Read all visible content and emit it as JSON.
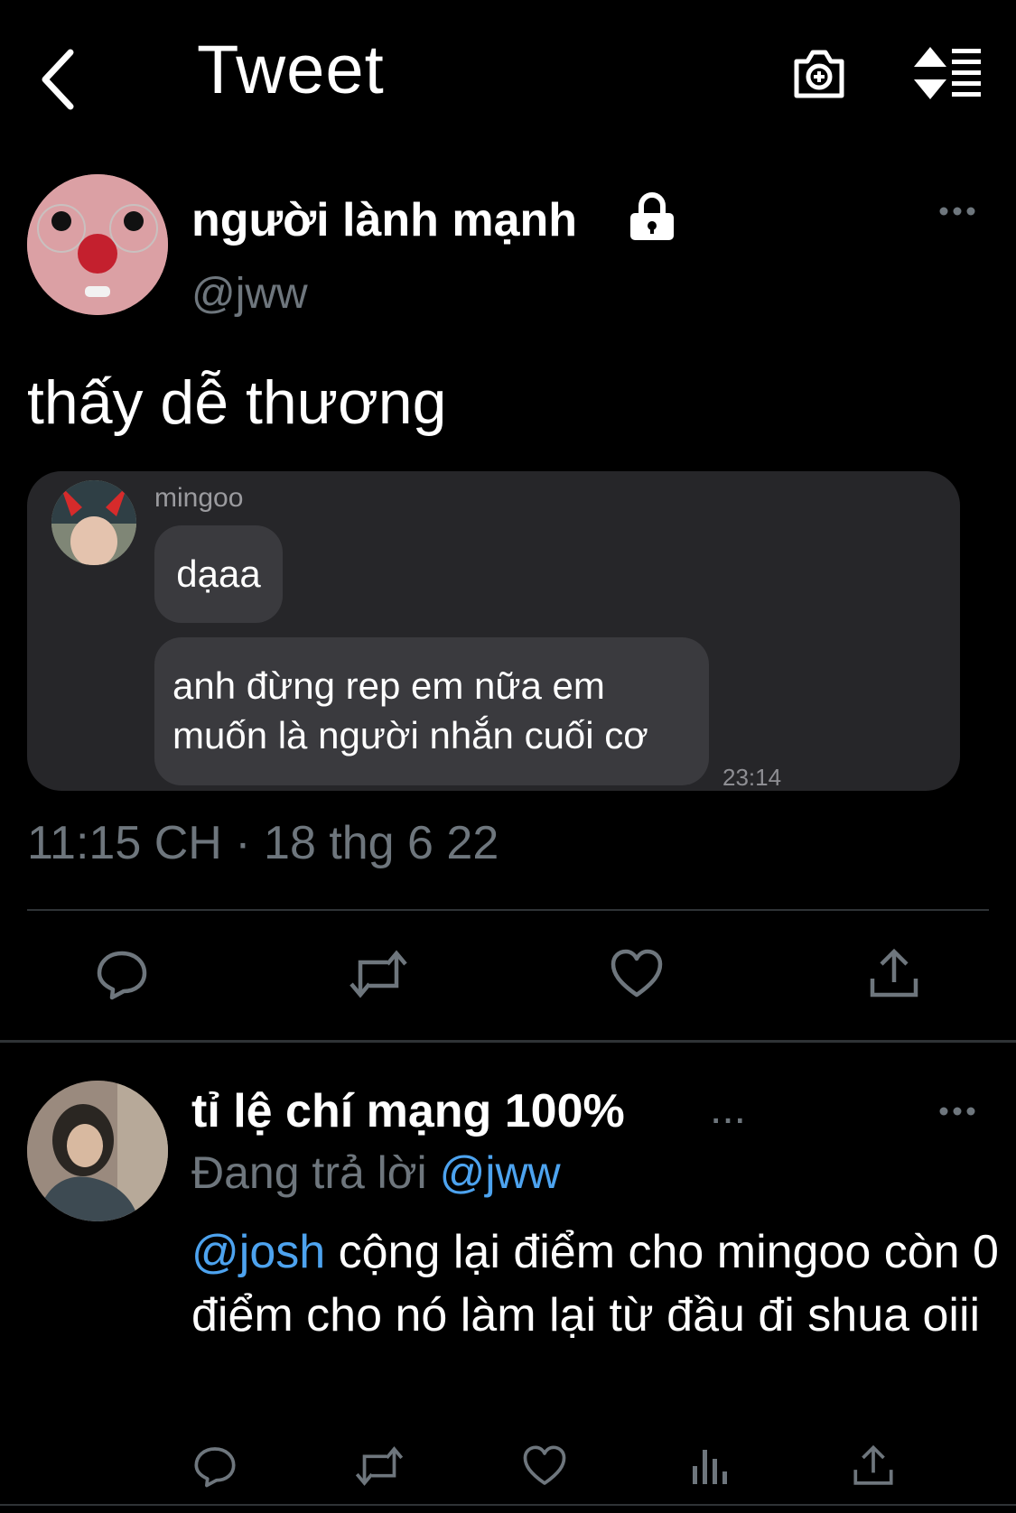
{
  "header": {
    "title": "Tweet",
    "back_icon": "chevron-left-icon",
    "camera_icon": "camera-add-icon",
    "sort_icon": "sort-icon"
  },
  "tweet": {
    "author_name": "người lành mạnh",
    "author_handle": "@jww",
    "text": "thấy dễ thương",
    "image": {
      "sender": "mingoo",
      "messages": [
        "dạaa",
        "anh đừng rep em nữa em\nmuốn là người nhắn cuối cơ"
      ],
      "time": "23:14"
    },
    "timestamp": "11:15 CH · 18 thg 6 22",
    "actions": [
      "reply-icon",
      "retweet-icon",
      "like-icon",
      "share-icon"
    ]
  },
  "reply": {
    "author_name": "tỉ lệ chí mạng 100%",
    "author_name_ellipsis": "...",
    "replying_prefix": "Đang trả lời",
    "replying_handle": "@jww",
    "mention": "@josh",
    "text": " cộng lại điểm cho mingoo còn 0 điểm cho nó làm lại từ đầu đi shua oiii",
    "actions": [
      "reply-icon",
      "retweet-icon",
      "like-icon",
      "analytics-icon",
      "share-icon"
    ]
  },
  "colors": {
    "background": "#000000",
    "secondary_text": "#6e767d",
    "link": "#4da3ef",
    "divider": "#2f3336",
    "chat_card": "#262629",
    "chat_bubble": "#3a3a3e"
  }
}
